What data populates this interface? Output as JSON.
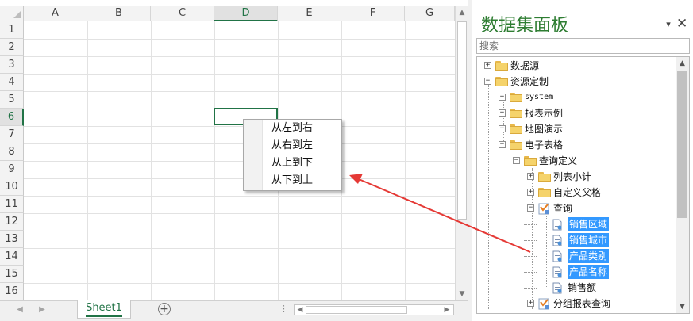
{
  "sheet": {
    "columns": [
      "A",
      "B",
      "C",
      "D",
      "E",
      "F",
      "G"
    ],
    "rows": [
      "1",
      "2",
      "3",
      "4",
      "5",
      "6",
      "7",
      "8",
      "9",
      "10",
      "11",
      "12",
      "13",
      "14",
      "15",
      "16"
    ],
    "tab_label": "Sheet1",
    "add_sheet": "+",
    "accent_color": "#217346"
  },
  "context_menu": {
    "items": [
      "从左到右",
      "从右到左",
      "从上到下",
      "从下到上"
    ]
  },
  "panel": {
    "title": "数据集面板",
    "pin": "▾",
    "close": "✕",
    "search_placeholder": "搜索",
    "tree": [
      {
        "label": "数据源",
        "expander": "+",
        "icon": "datasource-icon"
      },
      {
        "label": "资源定制",
        "expander": "−",
        "icon": "folder-icon"
      },
      {
        "label": "system",
        "expander": "+",
        "icon": "folder-icon"
      },
      {
        "label": "报表示例",
        "expander": "+",
        "icon": "folder-icon"
      },
      {
        "label": "地图演示",
        "expander": "+",
        "icon": "folder-icon"
      },
      {
        "label": "电子表格",
        "expander": "−",
        "icon": "folder-icon"
      },
      {
        "label": "查询定义",
        "expander": "−",
        "icon": "folder-icon"
      },
      {
        "label": "列表小计",
        "expander": "+",
        "icon": "folder-icon"
      },
      {
        "label": "自定义父格",
        "expander": "+",
        "icon": "folder-icon"
      },
      {
        "label": "查询",
        "expander": "−",
        "icon": "query-icon"
      },
      {
        "label": "销售区域",
        "icon": "field-icon",
        "selected": true
      },
      {
        "label": "销售城市",
        "icon": "field-icon",
        "selected": true
      },
      {
        "label": "产品类别",
        "icon": "field-icon",
        "selected": true
      },
      {
        "label": "产品名称",
        "icon": "field-icon",
        "selected": true
      },
      {
        "label": "销售额",
        "icon": "field-icon"
      },
      {
        "label": "分组报表查询",
        "expander": "+",
        "icon": "query-icon"
      }
    ],
    "title_color": "#2e7d32",
    "selection_color": "#3399ff"
  },
  "annotation": {
    "arrow_color": "#e53935"
  }
}
